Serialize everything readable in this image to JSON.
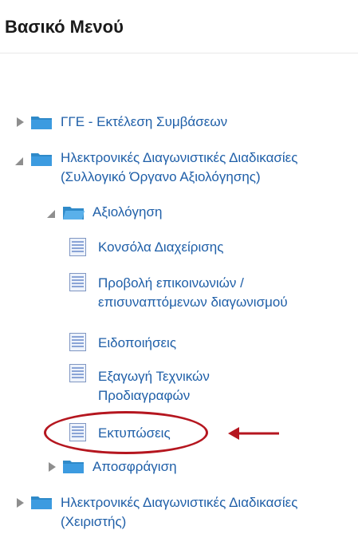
{
  "panel": {
    "title": "Βασικό Μενού"
  },
  "tree": {
    "item_gge": {
      "label": "ΓΓΕ - Εκτέλεση Συμβάσεων"
    },
    "item_electronic": {
      "label_line1": "Ηλεκτρονικές Διαγωνιστικές Διαδικασίες",
      "label_line2": "(Συλλογικό Όργανο Αξιολόγησης)"
    },
    "item_evaluation": {
      "label": "Αξιολόγηση"
    },
    "item_console": {
      "label": "Κονσόλα Διαχείρισης"
    },
    "item_view_comms": {
      "label_line1": "Προβολή επικοινωνιών /",
      "label_line2": "επισυναπτόμενων διαγωνισμού"
    },
    "item_notifications": {
      "label": "Ειδοποιήσεις"
    },
    "item_export_specs": {
      "label_line1": "Εξαγωγή Τεχνικών",
      "label_line2": "Προδιαγραφών"
    },
    "item_prints": {
      "label": "Εκτυπώσεις"
    },
    "item_unsealing": {
      "label": "Αποσφράγιση"
    },
    "item_electronic_operator": {
      "label_line1": "Ηλεκτρονικές Διαγωνιστικές Διαδικασίες",
      "label_line2": "(Χειριστής)"
    }
  },
  "colors": {
    "link": "#1f5fa8",
    "folder": "#2f8ac9",
    "annotation": "#b5161f"
  }
}
